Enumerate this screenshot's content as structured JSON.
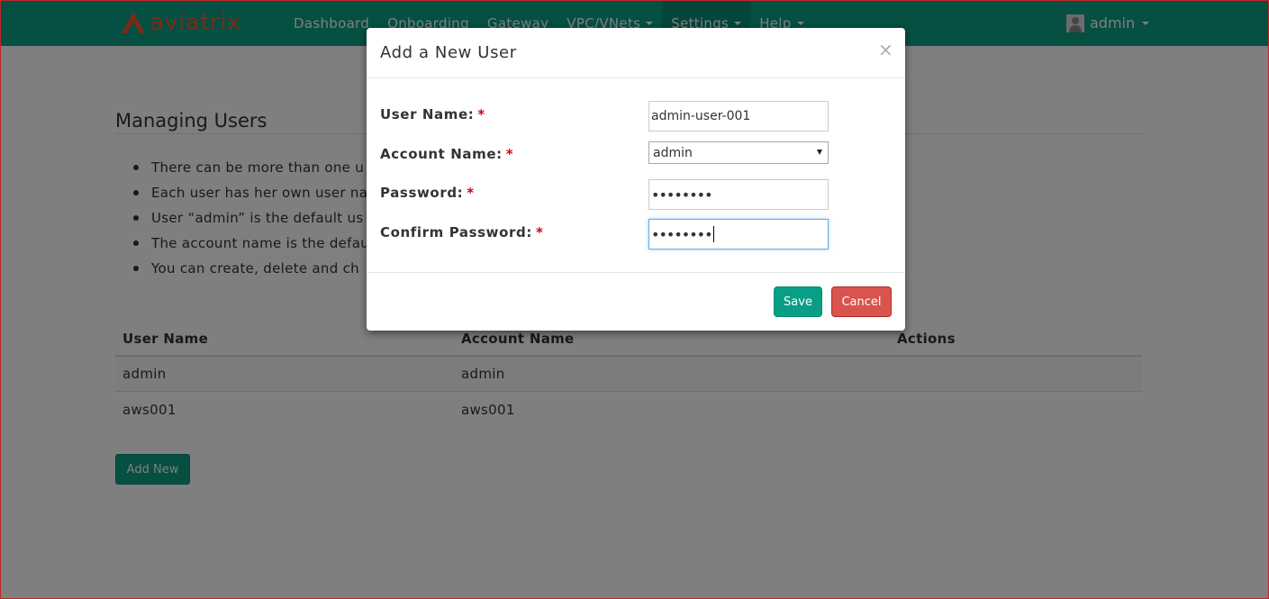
{
  "navbar": {
    "brand": "aviatrix",
    "items": [
      {
        "label": "Dashboard",
        "dropdown": false
      },
      {
        "label": "Onboarding",
        "dropdown": false
      },
      {
        "label": "Gateway",
        "dropdown": false
      },
      {
        "label": "VPC/VNets",
        "dropdown": true
      },
      {
        "label": "Settings",
        "dropdown": true
      },
      {
        "label": "Help",
        "dropdown": true
      }
    ],
    "active_item": "Settings",
    "user": "admin"
  },
  "page": {
    "title": "Managing Users",
    "bullets": [
      "There can be more than one u",
      "Each user has her own user na",
      "User “admin” is the default us",
      "The account name is the defau",
      "You can create, delete and ch"
    ]
  },
  "table": {
    "columns": [
      "User Name",
      "Account Name",
      "Actions"
    ],
    "rows": [
      {
        "user": "admin",
        "account": "admin"
      },
      {
        "user": "aws001",
        "account": "aws001"
      }
    ]
  },
  "add_new_label": "Add New",
  "modal": {
    "title": "Add a New User",
    "close": "×",
    "fields": {
      "user_name": {
        "label": "User Name:",
        "value": "admin-user-001"
      },
      "account_name": {
        "label": "Account Name:",
        "value": "admin"
      },
      "password": {
        "label": "Password:",
        "value": "••••••••"
      },
      "confirm_password": {
        "label": "Confirm Password:",
        "value": "••••••••"
      }
    },
    "required_mark": "*",
    "save_label": "Save",
    "cancel_label": "Cancel"
  },
  "colors": {
    "brand": "#0a9e86",
    "logo": "#ee5b2a",
    "danger": "#d9534f",
    "required": "#d0021b"
  }
}
